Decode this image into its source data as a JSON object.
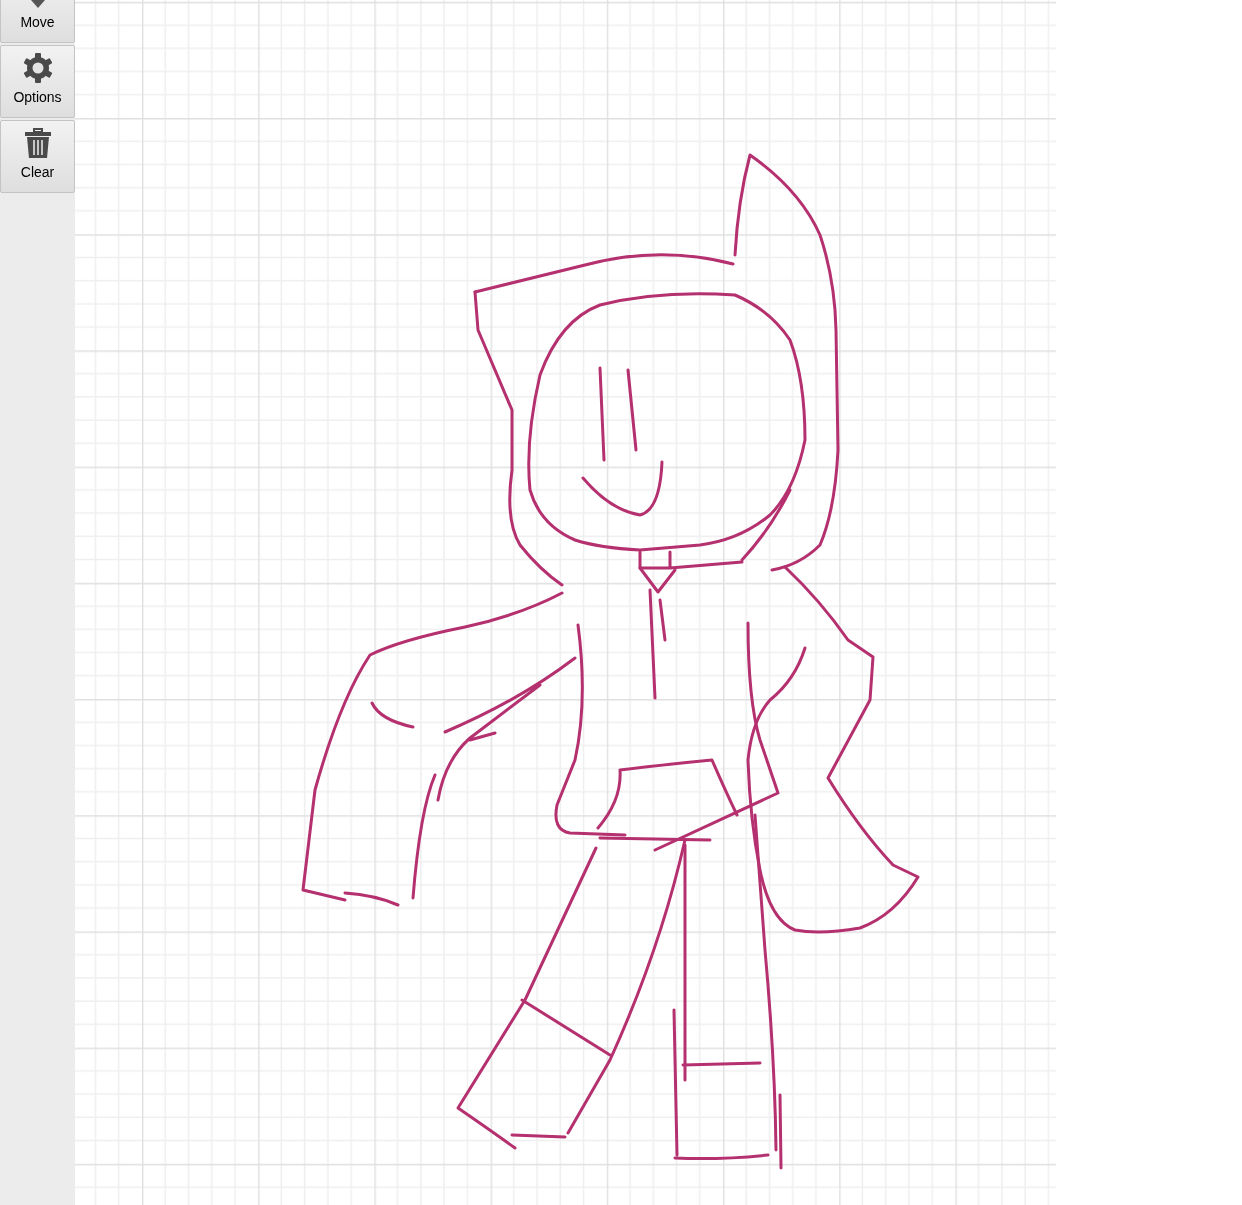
{
  "toolbar": {
    "buttons": [
      {
        "kind": "move",
        "label": "Move"
      },
      {
        "kind": "options",
        "label": "Options"
      },
      {
        "kind": "clear",
        "label": "Clear"
      }
    ]
  }
}
